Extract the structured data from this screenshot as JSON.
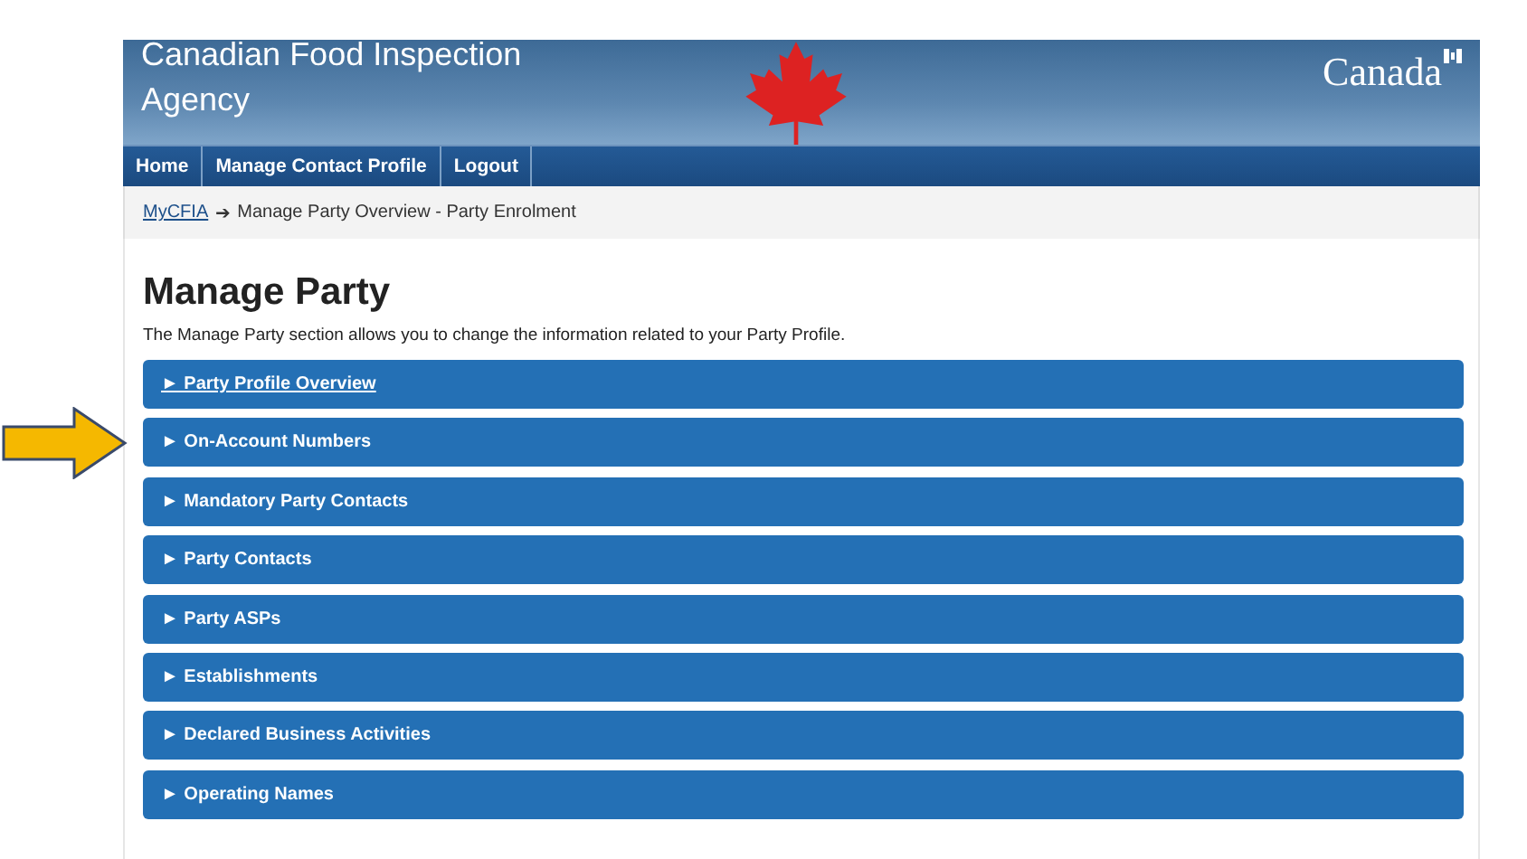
{
  "header": {
    "agency": "Canadian Food Inspection Agency",
    "wordmark": "Canada"
  },
  "nav": [
    {
      "label": "Home"
    },
    {
      "label": "Manage Contact Profile"
    },
    {
      "label": "Logout"
    }
  ],
  "breadcrumb": {
    "link": "MyCFIA",
    "arrow": "➔",
    "current": "Manage Party Overview - Party Enrolment"
  },
  "heading": "Manage Party",
  "description": "The Manage Party section allows you to change the information related to your Party Profile.",
  "sections": [
    {
      "marker": "►",
      "label": "Party Profile Overview",
      "underlined": true,
      "pointed": false
    },
    {
      "marker": "►",
      "label": "On-Account Numbers",
      "underlined": false,
      "pointed": true
    },
    {
      "marker": "►",
      "label": "Mandatory Party Contacts",
      "underlined": false,
      "pointed": false
    },
    {
      "marker": "►",
      "label": "Party Contacts",
      "underlined": false,
      "pointed": false
    },
    {
      "marker": "►",
      "label": "Party ASPs",
      "underlined": false,
      "pointed": false
    },
    {
      "marker": "►",
      "label": "Establishments",
      "underlined": false,
      "pointed": false
    },
    {
      "marker": "►",
      "label": "Declared Business Activities",
      "underlined": false,
      "pointed": false
    },
    {
      "marker": "►",
      "label": "Operating Names",
      "underlined": false,
      "pointed": false
    }
  ]
}
